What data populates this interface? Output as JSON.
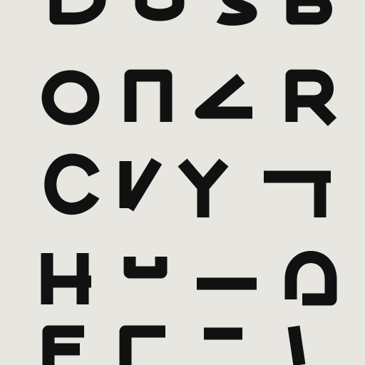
{
  "glyph_color": "#111111",
  "background_color": "#e7e6e1",
  "rows": [
    {
      "glyphs": [
        "D",
        "U",
        "S",
        "B"
      ]
    },
    {
      "glyphs": [
        "O",
        "Π",
        "Z",
        "R"
      ]
    },
    {
      "glyphs": [
        "C",
        "Y",
        "Y",
        "T"
      ]
    },
    {
      "glyphs": [
        "H",
        "U",
        "-",
        "Q"
      ]
    },
    {
      "glyphs": [
        "E",
        "F",
        "Z",
        "I"
      ]
    }
  ]
}
